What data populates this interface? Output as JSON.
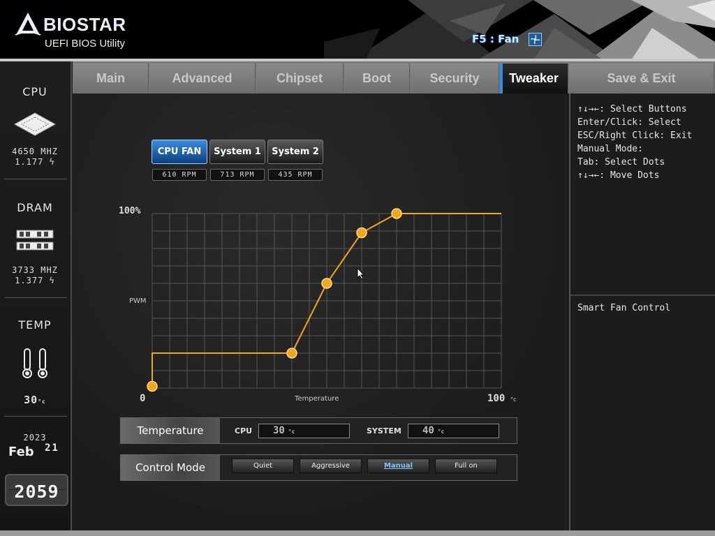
{
  "header": {
    "brand": "BIOSTAR",
    "subtitle": "UEFI BIOS Utility",
    "hotkey": "F5 : Fan",
    "hotkey_icon": "fan-icon"
  },
  "tabs": [
    {
      "label": "Main",
      "active": false
    },
    {
      "label": "Advanced",
      "active": false
    },
    {
      "label": "Chipset",
      "active": false
    },
    {
      "label": "Boot",
      "active": false
    },
    {
      "label": "Security",
      "active": false
    },
    {
      "label": "Tweaker",
      "active": true
    },
    {
      "label": "Save & Exit",
      "active": false
    }
  ],
  "sidebar": {
    "cpu": {
      "title": "CPU",
      "freq": "4650 MHZ",
      "volt": "1.177"
    },
    "dram": {
      "title": "DRAM",
      "freq": "3733 MHZ",
      "volt": "1.377"
    },
    "temp": {
      "title": "TEMP",
      "value": "30"
    },
    "date": {
      "year": "2023",
      "month": "Feb",
      "day": "21"
    },
    "clock": "2059"
  },
  "fans": [
    {
      "label": "CPU FAN",
      "rpm": "610 RPM",
      "active": true
    },
    {
      "label": "System 1",
      "rpm": "713 RPM",
      "active": false
    },
    {
      "label": "System 2",
      "rpm": "435 RPM",
      "active": false
    }
  ],
  "chart": {
    "y_max_label": "100%",
    "y_label": "PWM",
    "x_min_label": "0",
    "x_max_label": "100",
    "x_label": "Temperature",
    "line_color": "#f0a818"
  },
  "chart_data": {
    "type": "line",
    "xlabel": "Temperature",
    "ylabel": "PWM",
    "xlim": [
      0,
      100
    ],
    "ylim": [
      0,
      100
    ],
    "series": [
      {
        "x": [
          0,
          0,
          40,
          50,
          60,
          70,
          100
        ],
        "y": [
          1,
          20,
          20,
          60,
          89,
          100,
          100
        ]
      }
    ],
    "control_points": {
      "x": [
        0,
        40,
        50,
        60,
        70
      ],
      "y": [
        1,
        20,
        60,
        89,
        100
      ]
    }
  },
  "temperature_row": {
    "label": "Temperature",
    "cpu_label": "CPU",
    "cpu_value": "30",
    "system_label": "SYSTEM",
    "system_value": "40"
  },
  "control_mode": {
    "label": "Control Mode",
    "options": [
      {
        "label": "Quiet",
        "active": false
      },
      {
        "label": "Aggressive",
        "active": false
      },
      {
        "label": "Manual",
        "active": true
      },
      {
        "label": "Full on",
        "active": false
      }
    ]
  },
  "help": {
    "lines": [
      "↑↓→←: Select Buttons",
      "Enter/Click: Select",
      "ESC/Right Click: Exit",
      "Manual Mode:",
      "Tab: Select Dots",
      "↑↓→←: Move Dots"
    ],
    "description": "Smart Fan Control"
  }
}
